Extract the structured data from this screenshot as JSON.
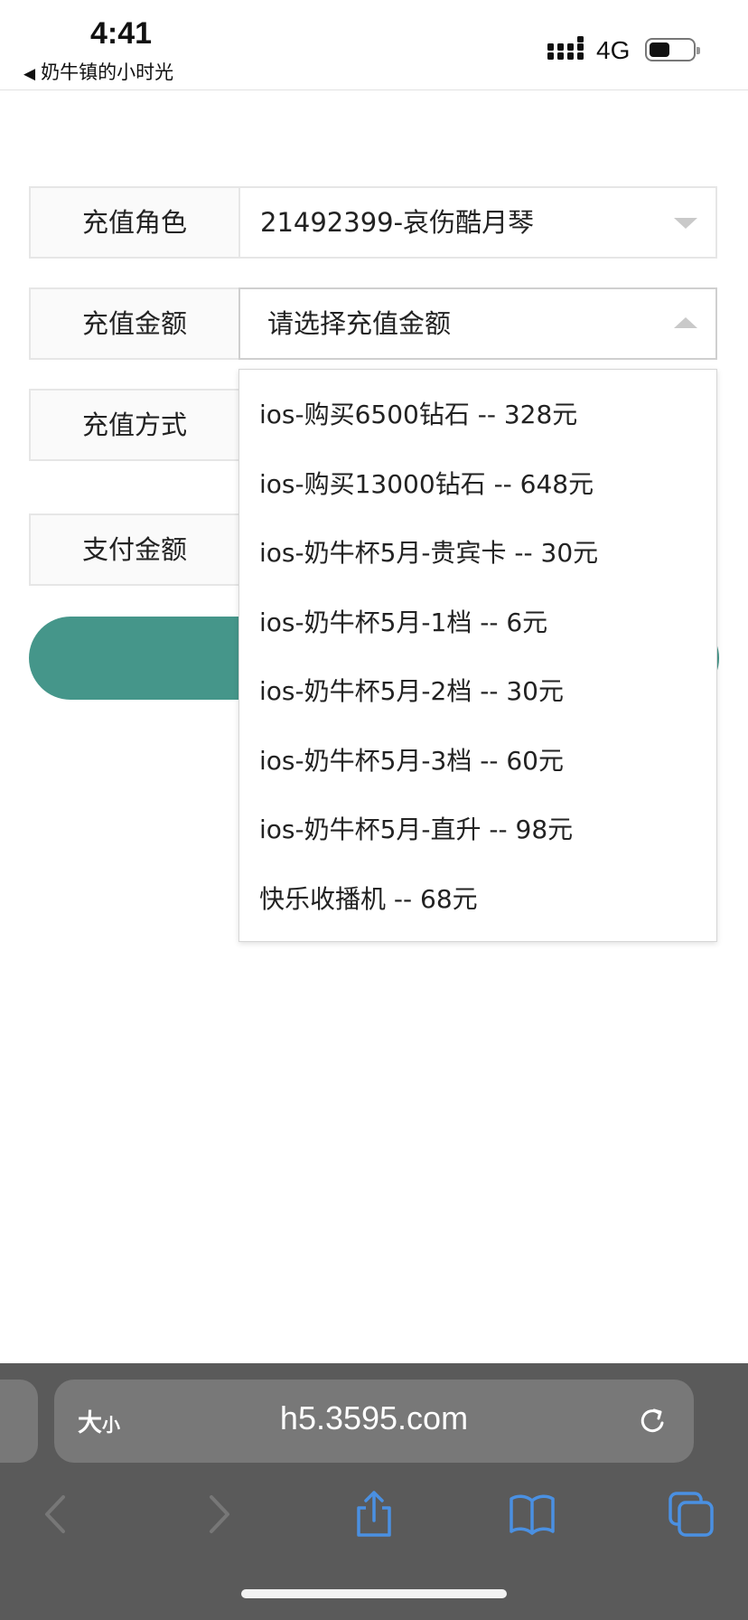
{
  "status_bar": {
    "time": "4:41",
    "back_app": "奶牛镇的小时光",
    "network": "4G"
  },
  "form": {
    "role": {
      "label": "充值角色",
      "value": "21492399-哀伤酷月琴"
    },
    "amount": {
      "label": "充值金额",
      "placeholder": "请选择充值金额"
    },
    "method": {
      "label": "充值方式"
    },
    "pay": {
      "label": "支付金额"
    }
  },
  "dropdown": {
    "options": [
      "ios-购买6500钻石 -- 328元",
      "ios-购买13000钻石 -- 648元",
      "ios-奶牛杯5月-贵宾卡 -- 30元",
      "ios-奶牛杯5月-1档 -- 6元",
      "ios-奶牛杯5月-2档 -- 30元",
      "ios-奶牛杯5月-3档 -- 60元",
      "ios-奶牛杯5月-直升 -- 98元",
      "快乐收播机 -- 68元"
    ]
  },
  "browser": {
    "text_size": "大",
    "text_size_small": "小",
    "url": "h5.3595.com"
  },
  "colors": {
    "accent": "#45968a",
    "toolbar_icon": "#4a90e2",
    "browser_bar": "#5a5a5a"
  }
}
